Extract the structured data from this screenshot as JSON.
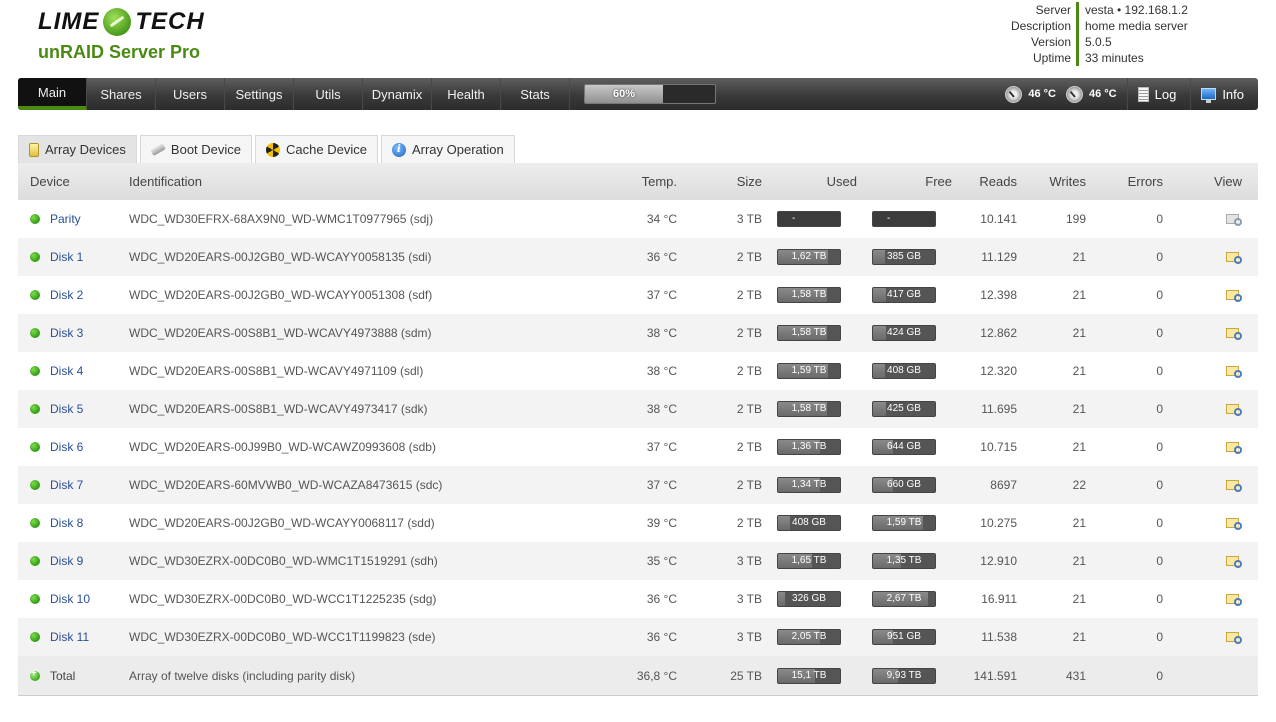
{
  "brand": {
    "logo_left": "LIME",
    "logo_right": "TECH",
    "logo_icon": "lime-slice-icon",
    "subtitle": "unRAID Server Pro"
  },
  "server_info": [
    {
      "label": "Server",
      "value": "vesta • 192.168.1.2"
    },
    {
      "label": "Description",
      "value": "home media server"
    },
    {
      "label": "Version",
      "value": "5.0.5"
    },
    {
      "label": "Uptime",
      "value": "33 minutes"
    }
  ],
  "nav": {
    "items": [
      "Main",
      "Shares",
      "Users",
      "Settings",
      "Utils",
      "Dynamix",
      "Health",
      "Stats"
    ],
    "active": "Main",
    "progress": {
      "percent": 60,
      "label": "60%"
    },
    "temps": [
      "46 °C",
      "46 °C"
    ],
    "log_label": "Log",
    "info_label": "Info"
  },
  "tabs": [
    {
      "label": "Array Devices",
      "icon": "disk-stack-icon"
    },
    {
      "label": "Boot Device",
      "icon": "usb-stick-icon"
    },
    {
      "label": "Cache Device",
      "icon": "radiation-icon"
    },
    {
      "label": "Array Operation",
      "icon": "info-icon"
    }
  ],
  "table": {
    "headers": {
      "device": "Device",
      "identification": "Identification",
      "temp": "Temp.",
      "size": "Size",
      "used": "Used",
      "free": "Free",
      "reads": "Reads",
      "writes": "Writes",
      "errors": "Errors",
      "view": "View"
    },
    "rows": [
      {
        "device": "Parity",
        "id": "WDC_WD30EFRX-68AX9N0_WD-WMC1T0977965 (sdj)",
        "temp": "34 °C",
        "size": "3 TB",
        "used": "-",
        "used_pct": 0,
        "free": "-",
        "free_pct": 0,
        "reads": "10.141",
        "writes": "199",
        "errors": "0",
        "view_state": "disabled"
      },
      {
        "device": "Disk 1",
        "id": "WDC_WD20EARS-00J2GB0_WD-WCAYY0058135 (sdi)",
        "temp": "36 °C",
        "size": "2 TB",
        "used": "1,62 TB",
        "used_pct": 0.81,
        "free": "385 GB",
        "free_pct": 0.19,
        "reads": "11.129",
        "writes": "21",
        "errors": "0",
        "view_state": "enabled"
      },
      {
        "device": "Disk 2",
        "id": "WDC_WD20EARS-00J2GB0_WD-WCAYY0051308 (sdf)",
        "temp": "37 °C",
        "size": "2 TB",
        "used": "1,58 TB",
        "used_pct": 0.79,
        "free": "417 GB",
        "free_pct": 0.21,
        "reads": "12.398",
        "writes": "21",
        "errors": "0",
        "view_state": "enabled"
      },
      {
        "device": "Disk 3",
        "id": "WDC_WD20EARS-00S8B1_WD-WCAVY4973888 (sdm)",
        "temp": "38 °C",
        "size": "2 TB",
        "used": "1,58 TB",
        "used_pct": 0.79,
        "free": "424 GB",
        "free_pct": 0.21,
        "reads": "12.862",
        "writes": "21",
        "errors": "0",
        "view_state": "enabled"
      },
      {
        "device": "Disk 4",
        "id": "WDC_WD20EARS-00S8B1_WD-WCAVY4971109 (sdl)",
        "temp": "38 °C",
        "size": "2 TB",
        "used": "1,59 TB",
        "used_pct": 0.8,
        "free": "408 GB",
        "free_pct": 0.2,
        "reads": "12.320",
        "writes": "21",
        "errors": "0",
        "view_state": "enabled"
      },
      {
        "device": "Disk 5",
        "id": "WDC_WD20EARS-00S8B1_WD-WCAVY4973417 (sdk)",
        "temp": "38 °C",
        "size": "2 TB",
        "used": "1,58 TB",
        "used_pct": 0.79,
        "free": "425 GB",
        "free_pct": 0.21,
        "reads": "11.695",
        "writes": "21",
        "errors": "0",
        "view_state": "enabled"
      },
      {
        "device": "Disk 6",
        "id": "WDC_WD20EARS-00J99B0_WD-WCAWZ0993608 (sdb)",
        "temp": "37 °C",
        "size": "2 TB",
        "used": "1,36 TB",
        "used_pct": 0.68,
        "free": "644 GB",
        "free_pct": 0.32,
        "reads": "10.715",
        "writes": "21",
        "errors": "0",
        "view_state": "enabled"
      },
      {
        "device": "Disk 7",
        "id": "WDC_WD20EARS-60MVWB0_WD-WCAZA8473615 (sdc)",
        "temp": "37 °C",
        "size": "2 TB",
        "used": "1,34 TB",
        "used_pct": 0.67,
        "free": "660 GB",
        "free_pct": 0.33,
        "reads": "8697",
        "writes": "22",
        "errors": "0",
        "view_state": "enabled"
      },
      {
        "device": "Disk 8",
        "id": "WDC_WD20EARS-00J2GB0_WD-WCAYY0068117 (sdd)",
        "temp": "39 °C",
        "size": "2 TB",
        "used": "408 GB",
        "used_pct": 0.2,
        "free": "1,59 TB",
        "free_pct": 0.8,
        "reads": "10.275",
        "writes": "21",
        "errors": "0",
        "view_state": "enabled"
      },
      {
        "device": "Disk 9",
        "id": "WDC_WD30EZRX-00DC0B0_WD-WMC1T1519291 (sdh)",
        "temp": "35 °C",
        "size": "3 TB",
        "used": "1,65 TB",
        "used_pct": 0.55,
        "free": "1,35 TB",
        "free_pct": 0.45,
        "reads": "12.910",
        "writes": "21",
        "errors": "0",
        "view_state": "enabled"
      },
      {
        "device": "Disk 10",
        "id": "WDC_WD30EZRX-00DC0B0_WD-WCC1T1225235 (sdg)",
        "temp": "36 °C",
        "size": "3 TB",
        "used": "326 GB",
        "used_pct": 0.11,
        "free": "2,67 TB",
        "free_pct": 0.89,
        "reads": "16.911",
        "writes": "21",
        "errors": "0",
        "view_state": "enabled"
      },
      {
        "device": "Disk 11",
        "id": "WDC_WD30EZRX-00DC0B0_WD-WCC1T1199823 (sde)",
        "temp": "36 °C",
        "size": "3 TB",
        "used": "2,05 TB",
        "used_pct": 0.68,
        "free": "951 GB",
        "free_pct": 0.32,
        "reads": "11.538",
        "writes": "21",
        "errors": "0",
        "view_state": "enabled"
      }
    ],
    "total": {
      "device": "Total",
      "id": "Array of twelve disks (including parity disk)",
      "temp": "36,8 °C",
      "size": "25 TB",
      "used": "15,1 TB",
      "used_pct": 0.6,
      "free": "9,93 TB",
      "free_pct": 0.4,
      "reads": "141.591",
      "writes": "431",
      "errors": "0"
    }
  }
}
